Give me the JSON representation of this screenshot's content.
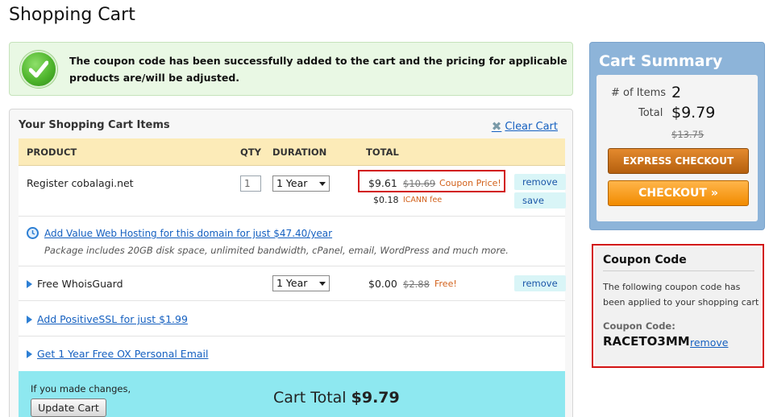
{
  "page": {
    "title": "Shopping Cart"
  },
  "notice": {
    "text": "The coupon code has been successfully added to the cart and the pricing for applicable products are/will be adjusted."
  },
  "cart": {
    "title": "Your Shopping Cart Items",
    "clear_label": "Clear Cart",
    "columns": {
      "product": "PRODUCT",
      "qty": "QTY",
      "duration": "DURATION",
      "total": "TOTAL"
    },
    "items": [
      {
        "product": "Register cobalagi.net",
        "qty": "1",
        "duration": "1 Year",
        "price": "$9.61",
        "old_price": "$10.69",
        "price_note": "Coupon Price!",
        "fee": "$0.18",
        "fee_label": "ICANN fee",
        "actions": {
          "remove": "remove",
          "save": "save"
        }
      },
      {
        "hosting_link": "Add Value Web Hosting for this domain for just $47.40/year",
        "hosting_desc": "Package includes 20GB disk space, unlimited bandwidth, cPanel, email, WordPress and much more."
      },
      {
        "product": "Free WhoisGuard",
        "duration": "1 Year",
        "price": "$0.00",
        "old_price": "$2.88",
        "price_note": "Free!",
        "actions": {
          "remove": "remove"
        }
      },
      {
        "link": "Add PositiveSSL for just $1.99"
      },
      {
        "link": "Get 1 Year Free OX Personal Email"
      }
    ],
    "footer": {
      "note": "If you made changes,",
      "update_label": "Update Cart",
      "total_label": "Cart Total",
      "total_value": "$9.79"
    }
  },
  "summary": {
    "title": "Cart Summary",
    "items_label": "# of Items",
    "items_value": "2",
    "total_label": "Total",
    "total_value": "$9.79",
    "old_total": "$13.75",
    "express_label": "EXPRESS CHECKOUT",
    "checkout_label": "CHECKOUT »"
  },
  "coupon": {
    "title": "Coupon Code",
    "text": "The following coupon code has been applied to your shopping cart",
    "code_label": "Coupon Code:",
    "code": "RACETO3MM",
    "remove_label": "remove"
  },
  "colors": {
    "notice_bg": "#e9f8e4",
    "table_head": "#fcebb8",
    "footer_bg": "#8ee8f0",
    "summary_bg": "#8db4d9",
    "highlight": "#d21212",
    "link": "#1560c0"
  },
  "icons": {
    "notice": "checkmark-circle-icon",
    "clear": "x-icon",
    "hosting": "clock-icon",
    "expand": "triangle-right-icon"
  }
}
